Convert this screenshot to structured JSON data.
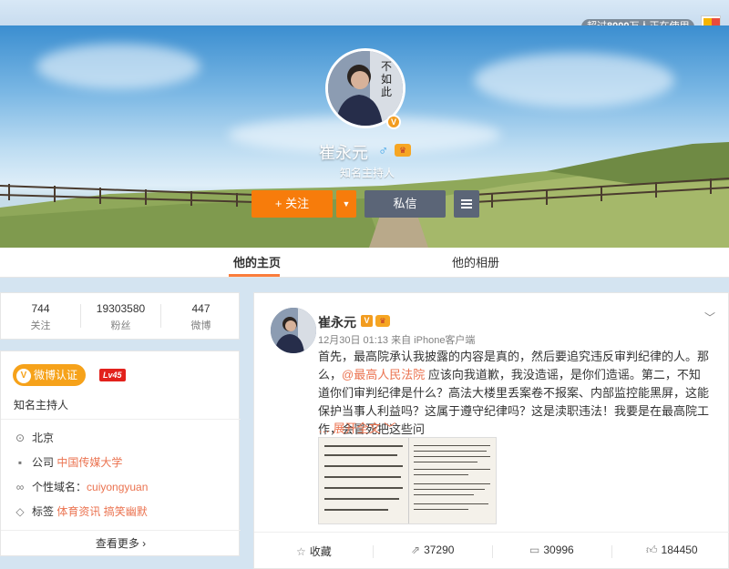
{
  "top": {
    "users_prefix": "超过",
    "users_count": "8000",
    "users_suffix": "万人正在使用"
  },
  "profile": {
    "name": "崔永元",
    "title": "知名主持人",
    "avatar_text": "不如此",
    "gender_icon": "male-icon",
    "follow_label": "+ 关注",
    "message_label": "私信"
  },
  "tabs": [
    {
      "label": "他的主页",
      "active": true
    },
    {
      "label": "他的相册",
      "active": false
    }
  ],
  "stats": [
    {
      "value": "744",
      "label": "关注"
    },
    {
      "value": "19303580",
      "label": "粉丝"
    },
    {
      "value": "447",
      "label": "微博"
    }
  ],
  "info": {
    "verify_label": "微博认证",
    "level": "Lv45",
    "title": "知名主持人",
    "location": "北京",
    "company_label": "公司",
    "company": "中国传媒大学",
    "domain_label": "个性域名：",
    "domain": "cuiyongyuan",
    "tags_label": "标签",
    "tag1": "体育资讯",
    "tag2": "搞笑幽默",
    "more": "查看更多 ›"
  },
  "post": {
    "author": "崔永元",
    "time": "12月30日 01:13",
    "source": "来自 iPhone客户端",
    "text_before": "首先，最高院承认我披露的内容是真的，然后要追究违反审判纪律的人。那么，",
    "mention": "@最高人民法院",
    "text_after": " 应该向我道歉，我没造谣，是你们造谣。第二，不知道你们审判纪律是什么？高法大楼里丢案卷不报案、内部监控能黑屏，这能保护当事人利益吗？这属于遵守纪律吗？这是渎职违法！我要是在最高院工作，会冒死把这些问",
    "expand": "… 展开全文 ﹀",
    "actions": {
      "collect": "收藏",
      "repost": "37290",
      "comment": "30996",
      "like": "184450"
    }
  },
  "colors": {
    "accent": "#f77c0b",
    "link": "#eb7350",
    "dark_button": "#5b6577"
  }
}
